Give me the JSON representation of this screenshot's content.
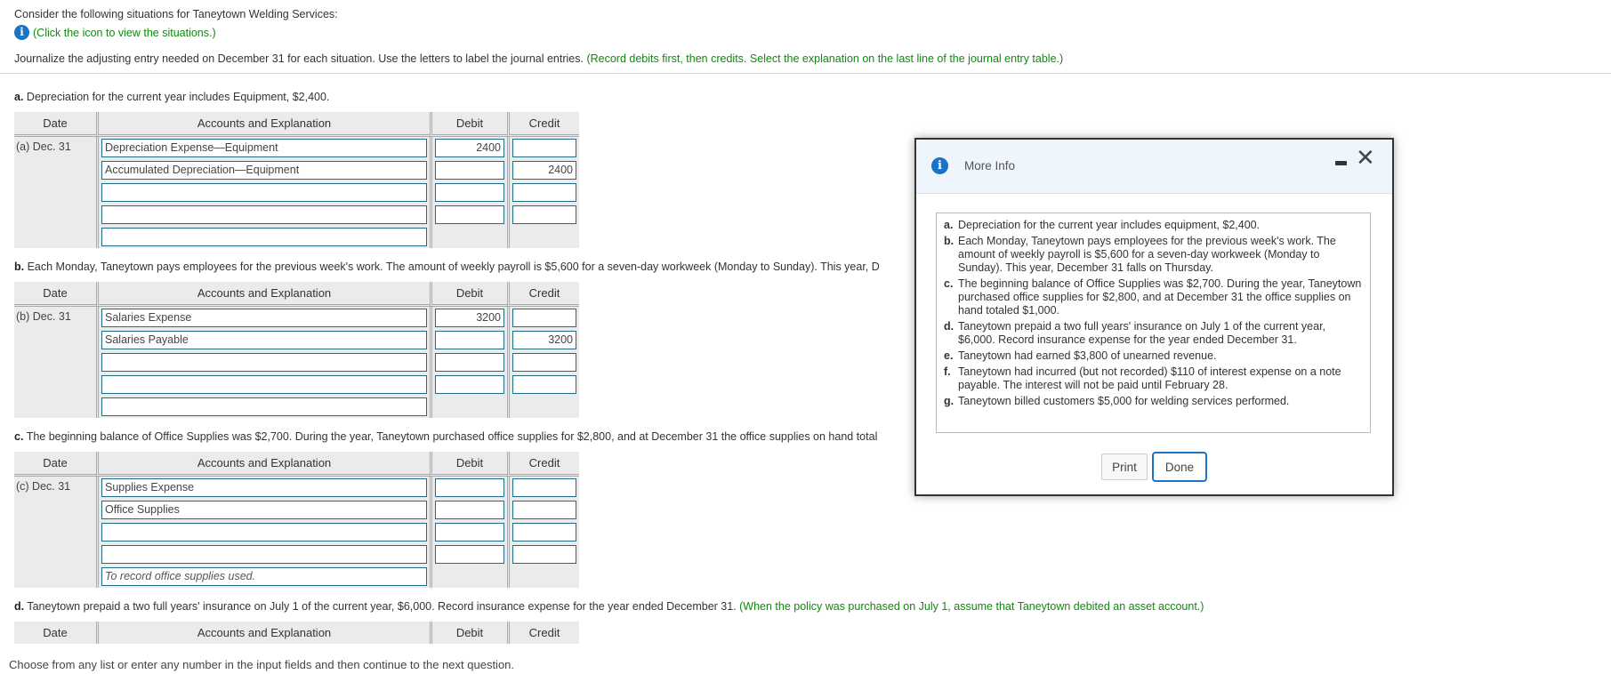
{
  "intro": {
    "line1": "Consider the following situations for Taneytown Welding Services:",
    "icon_link": "(Click the icon to view the situations.)",
    "instruction": "Journalize the adjusting entry needed on December 31 for each situation. Use the letters to label the journal entries.",
    "instruction_hint": "(Record debits first, then credits. Select the explanation on the last line of the journal entry table.)"
  },
  "table_headers": {
    "date": "Date",
    "accounts": "Accounts and Explanation",
    "debit": "Debit",
    "credit": "Credit"
  },
  "sections": [
    {
      "letter": "a.",
      "text": "Depreciation for the current year includes Equipment, $2,400.",
      "date": "(a) Dec. 31",
      "rows": [
        {
          "account": "Depreciation Expense—Equipment",
          "debit": "2400",
          "credit": ""
        },
        {
          "account": "Accumulated Depreciation—Equipment",
          "debit": "",
          "credit": "2400"
        },
        {
          "account": "",
          "debit": "",
          "credit": ""
        },
        {
          "account": "",
          "debit": "",
          "credit": ""
        }
      ],
      "explanation": ""
    },
    {
      "letter": "b.",
      "text": "Each Monday, Taneytown pays employees for the previous week's work. The amount of weekly payroll is $5,600 for a seven-day workweek (Monday to Sunday). This year, D",
      "date": "(b) Dec. 31",
      "rows": [
        {
          "account": "Salaries Expense",
          "debit": "3200",
          "credit": ""
        },
        {
          "account": "Salaries Payable",
          "debit": "",
          "credit": "3200"
        },
        {
          "account": "",
          "debit": "",
          "credit": ""
        },
        {
          "account": "",
          "debit": "",
          "credit": ""
        }
      ],
      "explanation": ""
    },
    {
      "letter": "c.",
      "text": "The beginning balance of Office Supplies was $2,700. During the year, Taneytown purchased office supplies for $2,800, and at December 31 the office supplies on hand total",
      "date": "(c) Dec. 31",
      "rows": [
        {
          "account": "Supplies Expense",
          "debit": "",
          "credit": ""
        },
        {
          "account": "Office Supplies",
          "debit": "",
          "credit": ""
        },
        {
          "account": "",
          "debit": "",
          "credit": ""
        },
        {
          "account": "",
          "debit": "",
          "credit": ""
        }
      ],
      "explanation": "To record office supplies used."
    },
    {
      "letter": "d.",
      "text": "Taneytown prepaid a two full years' insurance on July 1 of the current year, $6,000. Record insurance expense for the year ended December 31.",
      "hint": "(When the policy was purchased on July 1, assume that Taneytown debited an asset account.)"
    }
  ],
  "footer": "Choose from any list or enter any number in the input fields and then continue to the next question.",
  "modal": {
    "title": "More Info",
    "situations": [
      {
        "letter": "a.",
        "text": "Depreciation for the current year includes equipment, $2,400."
      },
      {
        "letter": "b.",
        "text": "Each Monday, Taneytown pays employees for the previous week's work. The amount of weekly payroll is $5,600 for a seven-day workweek (Monday to Sunday). This year, December 31 falls on Thursday."
      },
      {
        "letter": "c.",
        "text": "The beginning balance of Office Supplies was $2,700. During the year, Taneytown purchased office supplies for $2,800, and at December 31 the office supplies on hand totaled $1,000."
      },
      {
        "letter": "d.",
        "text": "Taneytown prepaid a two full years' insurance on July 1 of the current year, $6,000. Record insurance expense for the year ended December 31."
      },
      {
        "letter": "e.",
        "text": "Taneytown had earned $3,800 of unearned revenue."
      },
      {
        "letter": "f.",
        "text": "Taneytown had incurred (but not recorded) $110 of interest expense on a note payable. The interest will not be paid until February 28."
      },
      {
        "letter": "g.",
        "text": "Taneytown billed customers $5,000 for welding services performed."
      }
    ],
    "print_label": "Print",
    "done_label": "Done"
  }
}
